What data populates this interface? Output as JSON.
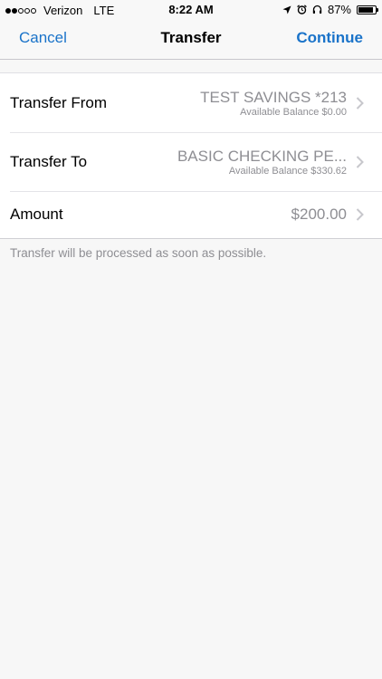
{
  "status_bar": {
    "carrier": "Verizon",
    "network": "LTE",
    "time": "8:22 AM",
    "battery": "87%",
    "battery_level": 0.87,
    "signal_bars": 2,
    "signal_total": 5
  },
  "nav": {
    "cancel_label": "Cancel",
    "title": "Transfer",
    "continue_label": "Continue"
  },
  "rows": [
    {
      "label": "Transfer From",
      "value": "TEST SAVINGS *213",
      "sub": "Available Balance $0.00"
    },
    {
      "label": "Transfer To",
      "value": "BASIC CHECKING PE...",
      "sub": "Available Balance $330.62"
    },
    {
      "label": "Amount",
      "value": "$200.00"
    }
  ],
  "footnote": "Transfer will be processed as soon as possible.",
  "colors": {
    "accent": "#1a73c9",
    "secondary_text": "#8e8e93",
    "background": "#f7f7f7"
  }
}
